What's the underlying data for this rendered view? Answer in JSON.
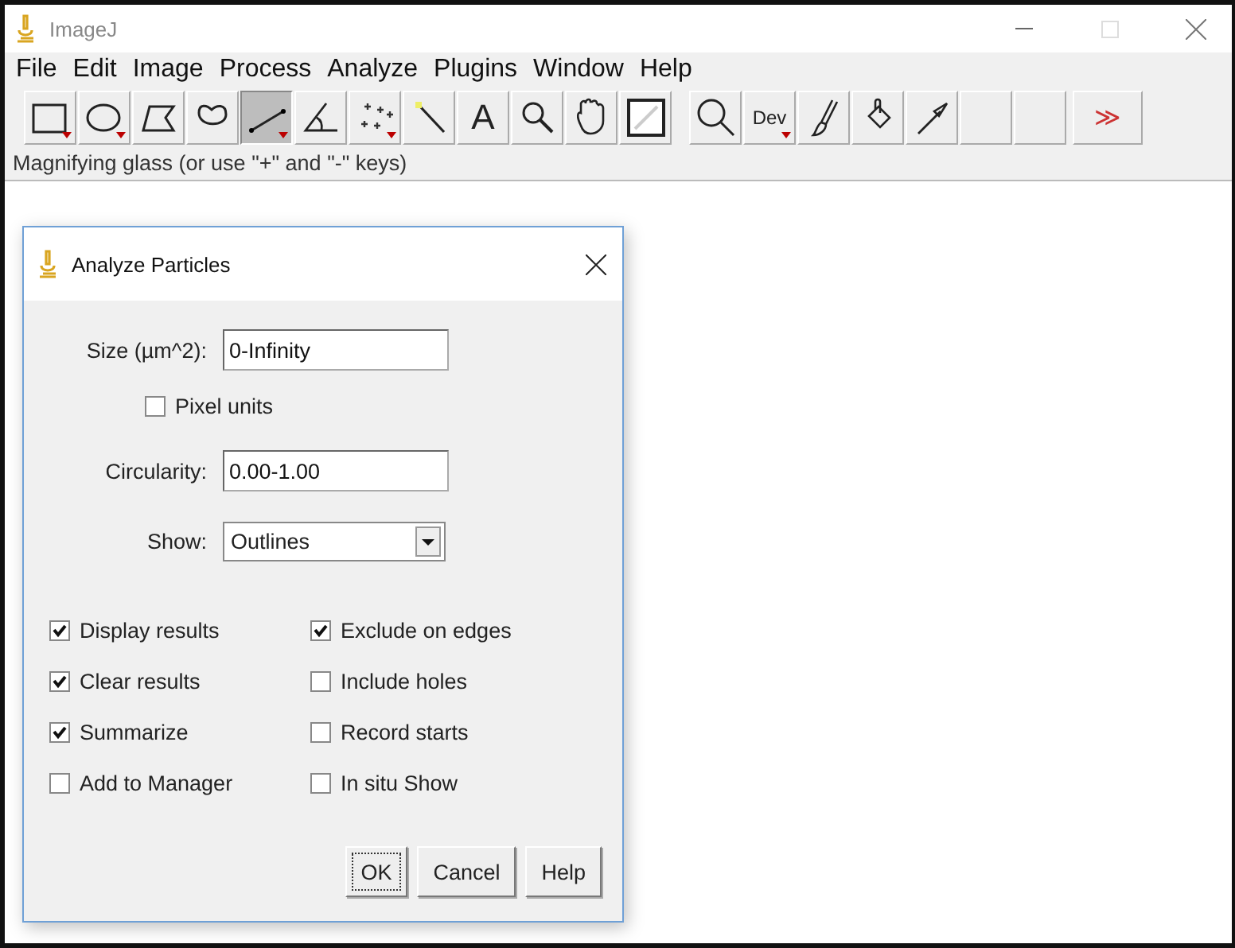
{
  "window": {
    "title": "ImageJ"
  },
  "menu": [
    "File",
    "Edit",
    "Image",
    "Process",
    "Analyze",
    "Plugins",
    "Window",
    "Help"
  ],
  "tools": [
    {
      "kind": "rectangle",
      "menu": true,
      "selected": false
    },
    {
      "kind": "oval",
      "menu": true,
      "selected": false
    },
    {
      "kind": "polygon",
      "menu": false,
      "selected": false
    },
    {
      "kind": "freehand",
      "menu": false,
      "selected": false
    },
    {
      "kind": "line",
      "menu": true,
      "selected": true
    },
    {
      "kind": "angle",
      "menu": false,
      "selected": false
    },
    {
      "kind": "points",
      "menu": true,
      "selected": false
    },
    {
      "kind": "wand",
      "menu": false,
      "selected": false
    },
    {
      "kind": "text",
      "label": "A",
      "menu": false,
      "selected": false
    },
    {
      "kind": "zoom",
      "menu": false,
      "selected": false
    },
    {
      "kind": "hand",
      "menu": false,
      "selected": false
    },
    {
      "kind": "dropper",
      "menu": false,
      "selected": false
    },
    {
      "kind": "gap"
    },
    {
      "kind": "magnifier",
      "menu": false,
      "selected": false
    },
    {
      "kind": "text",
      "label": "Dev",
      "menu": true,
      "selected": false
    },
    {
      "kind": "brush",
      "menu": false,
      "selected": false
    },
    {
      "kind": "bucket",
      "menu": false,
      "selected": false
    },
    {
      "kind": "arrow",
      "menu": false,
      "selected": false
    },
    {
      "kind": "blank",
      "menu": false,
      "selected": false
    },
    {
      "kind": "blank",
      "menu": false,
      "selected": false
    },
    {
      "kind": "more",
      "label": "≫",
      "menu": false,
      "selected": false
    }
  ],
  "status_bar": "Magnifying glass (or use \"+\" and \"-\" keys)",
  "dialog": {
    "title": "Analyze Particles",
    "size": {
      "label": "Size (µm^2):",
      "value": "0-Infinity"
    },
    "pixel_units": {
      "label": "Pixel units",
      "checked": false
    },
    "circularity": {
      "label": "Circularity:",
      "value": "0.00-1.00"
    },
    "show": {
      "label": "Show:",
      "value": "Outlines"
    },
    "options": [
      {
        "label": "Display results",
        "checked": true
      },
      {
        "label": "Exclude on edges",
        "checked": true
      },
      {
        "label": "Clear results",
        "checked": true
      },
      {
        "label": "Include holes",
        "checked": false
      },
      {
        "label": "Summarize",
        "checked": true
      },
      {
        "label": "Record starts",
        "checked": false
      },
      {
        "label": "Add to Manager",
        "checked": false
      },
      {
        "label": "In situ Show",
        "checked": false
      }
    ],
    "buttons": [
      {
        "label": "OK",
        "focused": true
      },
      {
        "label": "Cancel",
        "focused": false
      },
      {
        "label": "Help",
        "focused": false
      }
    ]
  }
}
